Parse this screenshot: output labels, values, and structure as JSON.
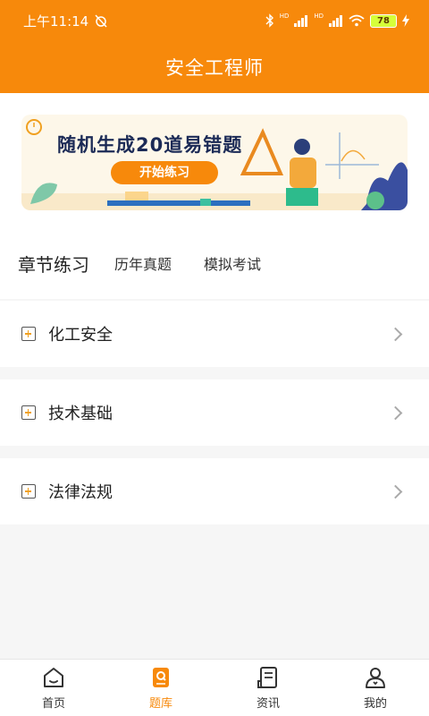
{
  "status_bar": {
    "time": "上午11:14",
    "network_label_1": "HD",
    "network_label_2": "HD",
    "battery": "78"
  },
  "header": {
    "title": "安全工程师"
  },
  "banner": {
    "headline": "随机生成20道易错题",
    "button": "开始练习"
  },
  "tabs": [
    {
      "label": "章节练习",
      "active": true
    },
    {
      "label": "历年真题",
      "active": false
    },
    {
      "label": "模拟考试",
      "active": false
    }
  ],
  "categories": [
    {
      "label": "化工安全"
    },
    {
      "label": "技术基础"
    },
    {
      "label": "法律法规"
    }
  ],
  "bottom_nav": [
    {
      "label": "首页",
      "icon": "home-icon"
    },
    {
      "label": "题库",
      "icon": "question-bank-icon",
      "active": true
    },
    {
      "label": "资讯",
      "icon": "news-icon"
    },
    {
      "label": "我的",
      "icon": "profile-icon"
    }
  ],
  "colors": {
    "accent": "#f7890b",
    "banner_bg": "#fdf7e9"
  }
}
